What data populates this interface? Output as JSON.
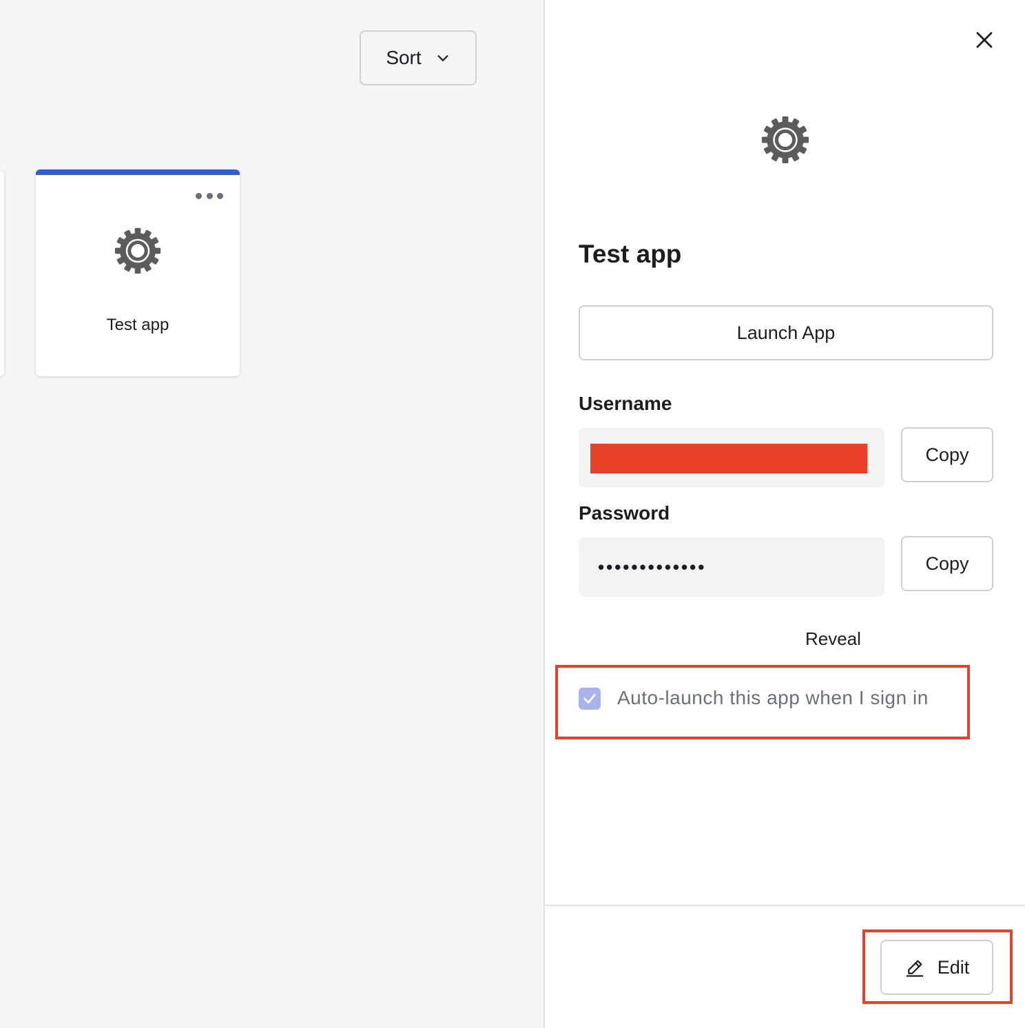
{
  "toolbar": {
    "sort_label": "Sort",
    "sort_icon": "chevron-down-icon"
  },
  "apps": [
    {
      "label": "Test app",
      "icon": "gear-icon",
      "menu_icon": "more-horizontal-icon"
    }
  ],
  "drawer": {
    "close_icon": "close-icon",
    "app_icon": "gear-icon",
    "title": "Test app",
    "launch_label": "Launch App",
    "username_label": "Username",
    "username_copy_label": "Copy",
    "password_label": "Password",
    "password_value": "•••••••••••••",
    "password_copy_label": "Copy",
    "reveal_label": "Reveal",
    "autolaunch_label": "Auto-launch this app when I sign in",
    "autolaunch_checked": true,
    "edit_label": "Edit",
    "edit_icon": "pencil-icon"
  },
  "colors": {
    "card_accent": "#2f5fd0",
    "checkbox_fill": "#a9b4ec",
    "highlight": "#e5422b",
    "redaction": "#e84127",
    "muted_text": "#6e6e78",
    "icon_gray": "#5c5c5c"
  }
}
